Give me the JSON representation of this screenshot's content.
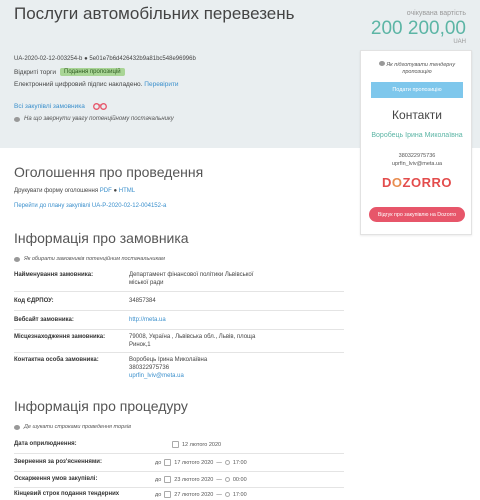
{
  "header": {
    "title": "Послуги автомобільних перевезень",
    "amount_label": "очікувана вартість",
    "amount": "200 200,00",
    "currency": "UAH",
    "tender_id": "UA-2020-02-12-003254-b",
    "tender_hash": "5e01e7b6d426432b9a81bc548e96996b",
    "status_prefix": "Відкриті торги",
    "status_badge": "Подання пропозицій",
    "signature_text": "Електронний цифровий підпис накладено.",
    "signature_link": "Перевірити",
    "all_purchases": "Всі закупівлі замовника",
    "attention": "На що звернути увагу потенційному постачальнику"
  },
  "sidebar": {
    "prep_note": "Як підготувати тендерну пропозицію",
    "submit_button": "Подати пропозицію",
    "contacts_title": "Контакти",
    "contact_name": "Воробець Ірина Миколаївна",
    "contact_phone": "380322975736",
    "contact_email": "uprfin_lviv@meta.ua",
    "logo_part1": "D",
    "logo_part2": "O",
    "logo_part3": "ZORRO",
    "dozorro_button": "Відгук про закупівлю на Dozorro"
  },
  "announcement": {
    "title": "Оголошення про проведення",
    "print_text": "Друкувати форму оголошення",
    "pdf": "PDF",
    "html": "HTML",
    "plan_link": "Перейти до плану закупівлі UA-P-2020-02-12-004152-a"
  },
  "customer": {
    "title": "Інформація про замовника",
    "note": "Як обирати замовників потенційним постачальникам",
    "rows": [
      {
        "label": "Найменування замовника:",
        "value": "Департамент фінансової політики Львівської міської ради"
      },
      {
        "label": "Код ЄДРПОУ:",
        "value": "34857384"
      },
      {
        "label": "Вебсайт замовника:",
        "value": "http://meta.ua"
      },
      {
        "label": "Місцезнаходження замовника:",
        "value": "79008, Україна , Львівська обл., Львів, площа Ринок,1"
      },
      {
        "label": "Контактна особа замовника:",
        "value": "Воробець Ірина Миколаївна",
        "phone": "380322975736",
        "email": "uprfin_lviv@meta.ua"
      }
    ]
  },
  "procedure": {
    "title": "Інформація про процедуру",
    "note": "Де шукати строками проведення торгів",
    "rows": [
      {
        "label": "Дата оприлюднення:",
        "prefix": "",
        "date": "12 лютого 2020",
        "time": ""
      },
      {
        "label": "Звернення за роз'ясненнями:",
        "prefix": "до",
        "date": "17 лютого 2020",
        "time": "17:00"
      },
      {
        "label": "Оскарження умов закупівлі:",
        "prefix": "до",
        "date": "23 лютого 2020",
        "time": "00:00"
      },
      {
        "label": "Кінцевий строк подання тендерних",
        "prefix": "до",
        "date": "27 лютого 2020",
        "time": "17:00"
      }
    ]
  },
  "colors": {
    "accent": "#5cb5a5",
    "link": "#3a8fcc",
    "badge": "#a9d596",
    "submit": "#7ec7ec",
    "dozorro": "#e7566a"
  }
}
